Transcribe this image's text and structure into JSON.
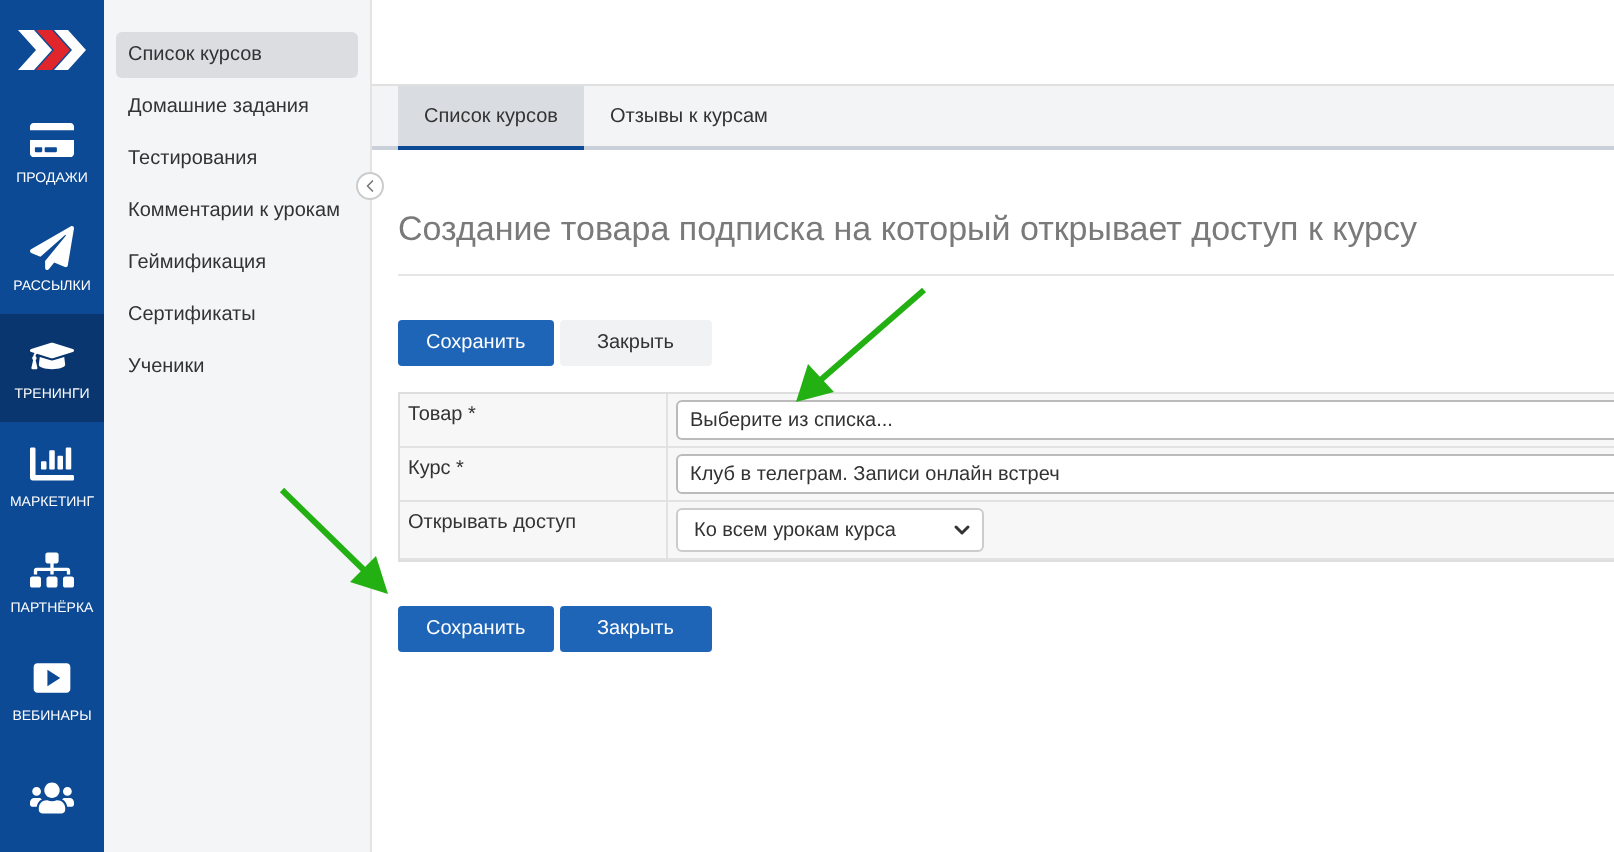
{
  "nav_rail": [
    {
      "label": "ПРОДАЖИ",
      "selected": false
    },
    {
      "label": "РАССЫЛКИ",
      "selected": false
    },
    {
      "label": "ТРЕНИНГИ",
      "selected": true
    },
    {
      "label": "МАРКЕТИНГ",
      "selected": false
    },
    {
      "label": "ПАРТНЁРКА",
      "selected": false
    },
    {
      "label": "ВЕБИНАРЫ",
      "selected": false
    },
    {
      "selected": false
    }
  ],
  "sidebar": {
    "items": [
      {
        "label": "Список курсов",
        "selected": true
      },
      {
        "label": "Домашние задания",
        "selected": false
      },
      {
        "label": "Тестирования",
        "selected": false
      },
      {
        "label": "Комментарии к урокам",
        "selected": false
      },
      {
        "label": "Геймификация",
        "selected": false
      },
      {
        "label": "Сертификаты",
        "selected": false
      },
      {
        "label": "Ученики",
        "selected": false
      }
    ]
  },
  "tabs": [
    {
      "label": "Список курсов",
      "selected": true
    },
    {
      "label": "Отзывы к курсам",
      "selected": false
    }
  ],
  "title": "Создание товара подписка на который открывает доступ к курсу",
  "top_buttons": [
    {
      "label": "Сохранить",
      "kind": "primary"
    },
    {
      "label": "Закрыть",
      "kind": "secondary"
    }
  ],
  "form": [
    {
      "label": "Товар *",
      "kind": "text",
      "placeholder": "Выберите из списка..."
    },
    {
      "label": "Курс *",
      "kind": "text",
      "value": "Клуб в телеграм. Записи онлайн встреч"
    },
    {
      "label": "Открывать доступ",
      "kind": "select",
      "value": "Ко всем урокам курса"
    }
  ],
  "bottom_buttons": [
    {
      "label": "Сохранить",
      "kind": "primary"
    },
    {
      "label": "Закрыть",
      "kind": "primary"
    }
  ]
}
